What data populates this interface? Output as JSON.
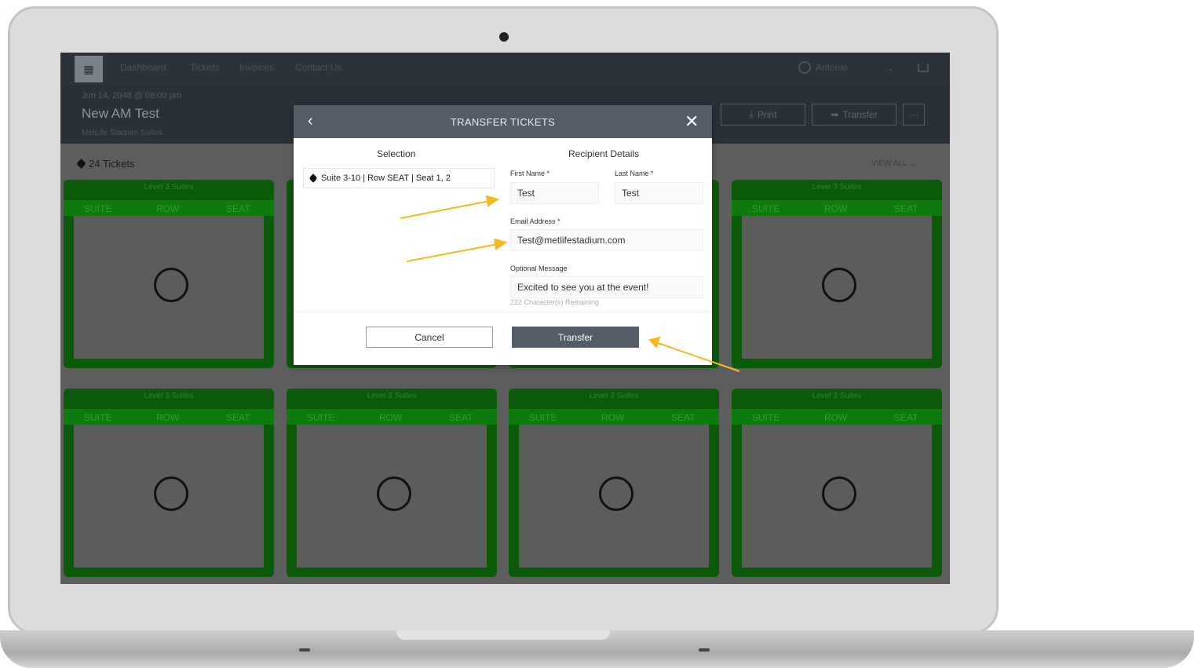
{
  "nav": {
    "links": [
      "Dashboard",
      "Tickets",
      "Invoices",
      "Contact Us"
    ],
    "user": "Antonio"
  },
  "event": {
    "date": "Jun 14, 2048 @ 08:00 pm",
    "title": "New AM Test",
    "venue": "MetLife Stadium Suites",
    "print_label": "Print",
    "transfer_label": "Transfer",
    "more_label": "···"
  },
  "tickets": {
    "count_label": "24 Tickets",
    "view_all": "VIEW ALL",
    "card_level": "Level 3 Suites",
    "col_suite": "SUITE",
    "col_row": "ROW",
    "col_seat": "SEAT"
  },
  "modal": {
    "title": "TRANSFER TICKETS",
    "back_icon": "‹",
    "close_icon": "✕",
    "selection_title": "Selection",
    "recipient_title": "Recipient Details",
    "selection_item": "Suite 3-10 | Row SEAT | Seat 1, 2",
    "first_name_label": "First Name *",
    "first_name_value": "Test",
    "last_name_label": "Last Name *",
    "last_name_value": "Test",
    "email_label": "Email Address *",
    "email_value": "Test@metlifestadium.com",
    "message_label": "Optional Message",
    "message_value": "Excited to see you at the event!",
    "chars_remaining": "222 Character(s) Remaining",
    "cancel_label": "Cancel",
    "transfer_label": "Transfer"
  },
  "colors": {
    "accent": "#545c67",
    "card_green": "#0d7a0d",
    "arrow": "#f5b921"
  }
}
